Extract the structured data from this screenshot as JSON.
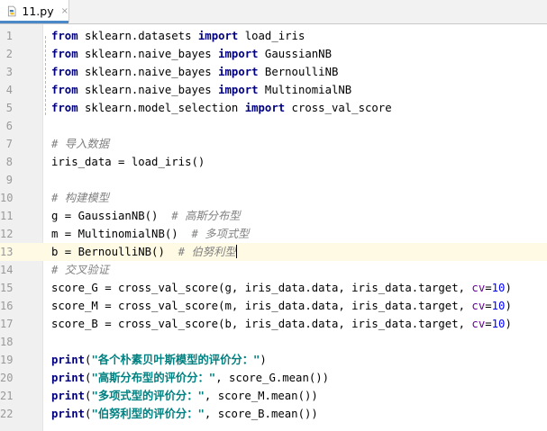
{
  "tab": {
    "filename": "11.py",
    "icon": "python-file-icon",
    "close_glyph": "×"
  },
  "current_line": 13,
  "lines": [
    {
      "n": "1",
      "tokens": [
        [
          "kw",
          "from"
        ],
        [
          "",
          " sklearn.datasets "
        ],
        [
          "kw",
          "import"
        ],
        [
          "",
          " load_iris"
        ]
      ]
    },
    {
      "n": "2",
      "tokens": [
        [
          "kw",
          "from"
        ],
        [
          "",
          " sklearn.naive_bayes "
        ],
        [
          "kw",
          "import"
        ],
        [
          "",
          " GaussianNB"
        ]
      ]
    },
    {
      "n": "3",
      "tokens": [
        [
          "kw",
          "from"
        ],
        [
          "",
          " sklearn.naive_bayes "
        ],
        [
          "kw",
          "import"
        ],
        [
          "",
          " BernoulliNB"
        ]
      ]
    },
    {
      "n": "4",
      "tokens": [
        [
          "kw",
          "from"
        ],
        [
          "",
          " sklearn.naive_bayes "
        ],
        [
          "kw",
          "import"
        ],
        [
          "",
          " MultinomialNB"
        ]
      ]
    },
    {
      "n": "5",
      "tokens": [
        [
          "kw",
          "from"
        ],
        [
          "",
          " sklearn.model_selection "
        ],
        [
          "kw",
          "import"
        ],
        [
          "",
          " cross_val_score"
        ]
      ]
    },
    {
      "n": "6",
      "tokens": []
    },
    {
      "n": "7",
      "tokens": [
        [
          "cm",
          "# 导入数据"
        ]
      ]
    },
    {
      "n": "8",
      "tokens": [
        [
          "",
          "iris_data = load_iris()"
        ]
      ]
    },
    {
      "n": "9",
      "tokens": []
    },
    {
      "n": "10",
      "tokens": [
        [
          "cm",
          "# 构建模型"
        ]
      ]
    },
    {
      "n": "11",
      "tokens": [
        [
          "",
          "g = GaussianNB()  "
        ],
        [
          "cm",
          "# 高斯分布型"
        ]
      ]
    },
    {
      "n": "12",
      "tokens": [
        [
          "",
          "m = MultinomialNB()  "
        ],
        [
          "cm",
          "# 多项式型"
        ]
      ]
    },
    {
      "n": "13",
      "tokens": [
        [
          "",
          "b = BernoulliNB()  "
        ],
        [
          "cm",
          "# 伯努利型"
        ],
        [
          "caret",
          ""
        ]
      ]
    },
    {
      "n": "14",
      "tokens": [
        [
          "cm",
          "# 交叉验证"
        ]
      ]
    },
    {
      "n": "15",
      "tokens": [
        [
          "",
          "score_G = cross_val_score(g, iris_data.data, iris_data.target, "
        ],
        [
          "pk",
          "cv"
        ],
        [
          "",
          "="
        ],
        [
          "nm",
          "10"
        ],
        [
          "",
          ")"
        ]
      ]
    },
    {
      "n": "16",
      "tokens": [
        [
          "",
          "score_M = cross_val_score(m, iris_data.data, iris_data.target, "
        ],
        [
          "pk",
          "cv"
        ],
        [
          "",
          "="
        ],
        [
          "nm",
          "10"
        ],
        [
          "",
          ")"
        ]
      ]
    },
    {
      "n": "17",
      "tokens": [
        [
          "",
          "score_B = cross_val_score(b, iris_data.data, iris_data.target, "
        ],
        [
          "pk",
          "cv"
        ],
        [
          "",
          "="
        ],
        [
          "nm",
          "10"
        ],
        [
          "",
          ")"
        ]
      ]
    },
    {
      "n": "18",
      "tokens": []
    },
    {
      "n": "19",
      "tokens": [
        [
          "kw",
          "print"
        ],
        [
          "",
          "("
        ],
        [
          "st",
          "\"各个朴素贝叶斯模型的评价分：\""
        ],
        [
          "",
          ")"
        ]
      ]
    },
    {
      "n": "20",
      "tokens": [
        [
          "kw",
          "print"
        ],
        [
          "",
          "("
        ],
        [
          "st",
          "\"高斯分布型的评价分：\""
        ],
        [
          "",
          ", score_G.mean())"
        ]
      ]
    },
    {
      "n": "21",
      "tokens": [
        [
          "kw",
          "print"
        ],
        [
          "",
          "("
        ],
        [
          "st",
          "\"多项式型的评价分：\""
        ],
        [
          "",
          ", score_M.mean())"
        ]
      ]
    },
    {
      "n": "22",
      "tokens": [
        [
          "kw",
          "print"
        ],
        [
          "",
          "("
        ],
        [
          "st",
          "\"伯努利型的评价分：\""
        ],
        [
          "",
          ", score_B.mean())"
        ]
      ]
    }
  ]
}
